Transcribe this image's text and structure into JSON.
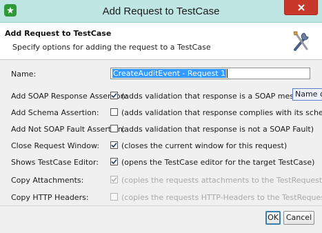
{
  "window": {
    "title": "Add Request to TestCase",
    "icon": "soapui-icon",
    "close_icon": "close-icon"
  },
  "header": {
    "title": "Add Request to TestCase",
    "subtitle": "Specify options for adding the request to a TestCase",
    "icon": "tools-icon"
  },
  "form": {
    "name": {
      "label": "Name:",
      "value": "CreateAuditEvent - Request 1"
    },
    "options": [
      {
        "label": "Add SOAP Response Assertion:",
        "checked": true,
        "enabled": true,
        "description": "(adds validation that response is a SOAP message)"
      },
      {
        "label": "Add Schema Assertion:",
        "checked": false,
        "enabled": true,
        "description": "(adds validation that response complies with its schema)"
      },
      {
        "label": "Add Not SOAP Fault Assertion:",
        "checked": false,
        "enabled": true,
        "description": "(adds validation that response is not a SOAP Fault)"
      },
      {
        "label": "Close Request Window:",
        "checked": true,
        "enabled": true,
        "description": "(closes the current window for this request)"
      },
      {
        "label": "Shows TestCase Editor:",
        "checked": true,
        "enabled": true,
        "description": "(opens the TestCase editor for the target TestCase)"
      },
      {
        "label": "Copy Attachments:",
        "checked": true,
        "enabled": false,
        "description": "(copies the requests attachments to the TestRequest)"
      },
      {
        "label": "Copy HTTP Headers:",
        "checked": false,
        "enabled": false,
        "description": "(copies the requests HTTP-Headers to the TestRequest)"
      }
    ]
  },
  "tooltip": {
    "text": "Name of"
  },
  "buttons": {
    "ok": "OK",
    "cancel": "Cancel"
  },
  "colors": {
    "titlebar": "#bfe6e2",
    "close": "#c7372a",
    "selection": "#3399ff",
    "default_button_border": "#3c7fb1"
  }
}
